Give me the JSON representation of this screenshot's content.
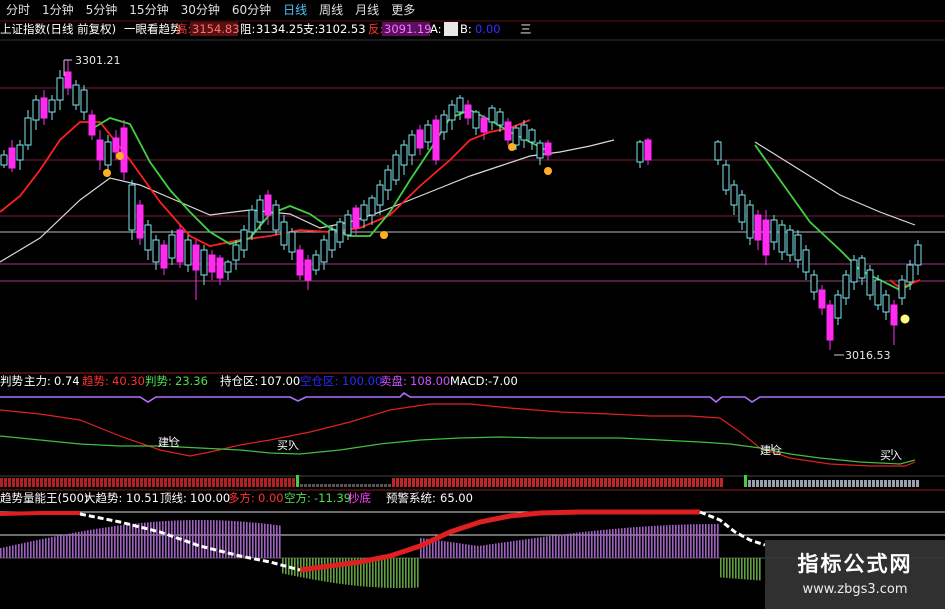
{
  "tabs": [
    "分时",
    "1分钟",
    "5分钟",
    "15分钟",
    "30分钟",
    "60分钟",
    "日线",
    "周线",
    "月线",
    "更多"
  ],
  "active_tab": "日线",
  "main_header": {
    "title": "上证指数(日线 前复权)",
    "indicator_name": "一眼看趋势",
    "high_label": "高:",
    "high_value": "3154.83",
    "resist_label": "阻:",
    "resist_value": "3134.25",
    "support_label": "支:",
    "support_value": "3102.53",
    "rebound_label": "反:",
    "rebound_value": "3091.19",
    "a_label": "A:",
    "b_label": "B:",
    "b_value": "0.00",
    "more": "三"
  },
  "price_annotations": {
    "high": "3301.21",
    "low": "3016.53"
  },
  "indicator_bar": {
    "prefix": "判势",
    "zhuli_label": "主力:",
    "zhuli_value": "0.74",
    "qushi_label": "趋势:",
    "qushi_value": "40.30",
    "panshi_label": "判势:",
    "panshi_value": "23.36",
    "chicang_label": "持仓区:",
    "chicang_value": "107.00",
    "kongcang_label": "空仓区:",
    "kongcang_value": "100.00",
    "maipan_label": "卖盘:",
    "maipan_value": "108.00",
    "macd_label": "MACD:",
    "macd_value": "-7.00"
  },
  "indicator_labels": {
    "build_1": "建仓",
    "buy_1": "买入",
    "build_2": "建仓",
    "buy_2": "买入"
  },
  "vol_bar": {
    "title": "趋势量能王(500)",
    "dqs_label": "大趋势:",
    "dqs_value": "10.51",
    "dingxian_label": "顶线:",
    "dingxian_value": "100.00",
    "duofang_label": "多方:",
    "duofang_value": "0.00",
    "kongfang_label": "空方:",
    "kongfang_value": "-11.39",
    "chaodi": "抄底",
    "yujing_label": "预警系统:",
    "yujing_value": "65.00"
  },
  "watermark": {
    "line1": "指标公式网",
    "line2": "www.zbgs3.com"
  },
  "colors": {
    "up": "#7ce6ee",
    "down": "#ff2bf0",
    "red_line": "#ff2020",
    "green_line": "#40d040",
    "white_line": "#d0d0d0"
  }
}
